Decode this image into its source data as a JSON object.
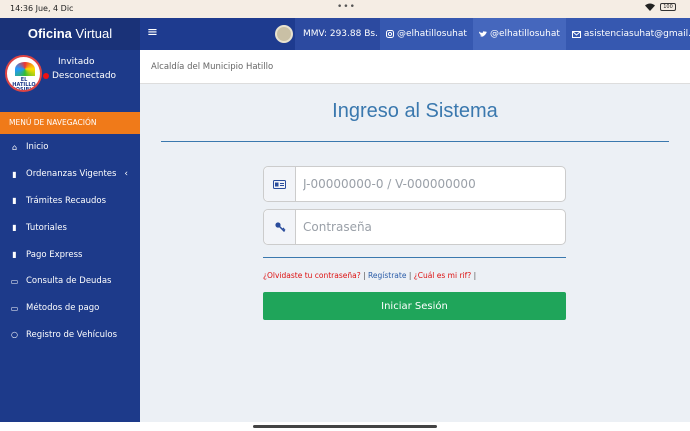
{
  "statusbar": {
    "time": "14:36  Jue, 4 Dic",
    "dots": "•••",
    "battery": "100"
  },
  "topbar": {
    "brand_a": "Oficina",
    "brand_b": "Virtual",
    "menu_icon": "hamburger-icon",
    "mmv": "MMV: 293.88 Bs.",
    "instagram": "@elhatillosuhat",
    "twitter": "@elhatillosuhat",
    "email": "asistenciasuhat@gmail.com"
  },
  "user": {
    "name": "Invitado",
    "status": "Desconectado",
    "logo_text": "EL HATILLO POSIBLE"
  },
  "nav": {
    "header": "MENÚ DE NAVEGACIÓN",
    "items": [
      {
        "icon": "home-icon",
        "label": "Inicio"
      },
      {
        "icon": "file-icon",
        "label": "Ordenanzas Vigentes",
        "has_chevron": true
      },
      {
        "icon": "file-icon",
        "label": "Trámites Recaudos"
      },
      {
        "icon": "file-icon",
        "label": "Tutoriales"
      },
      {
        "icon": "file-icon",
        "label": "Pago Express"
      },
      {
        "icon": "money-icon",
        "label": "Consulta de Deudas"
      },
      {
        "icon": "money-icon",
        "label": "Métodos de pago"
      },
      {
        "icon": "circle-icon",
        "label": "Registro de Vehículos"
      }
    ]
  },
  "main": {
    "breadcrumb": "Alcaldía del Municipio Hatillo",
    "title": "Ingreso al Sistema",
    "id_placeholder": "J-00000000-0 / V-000000000",
    "password_placeholder": "Contraseña",
    "forgot": "¿Olvidaste tu contraseña?",
    "sep1": " | ",
    "register": "Regístrate",
    "sep2": " | ",
    "rif": "¿Cuál es mi rif?",
    "sep3": " |",
    "submit": "Iniciar Sesión"
  },
  "colors": {
    "primary": "#1d3a8a",
    "accent": "#f07a19",
    "success": "#1fa55a",
    "title": "#3a78ae"
  }
}
